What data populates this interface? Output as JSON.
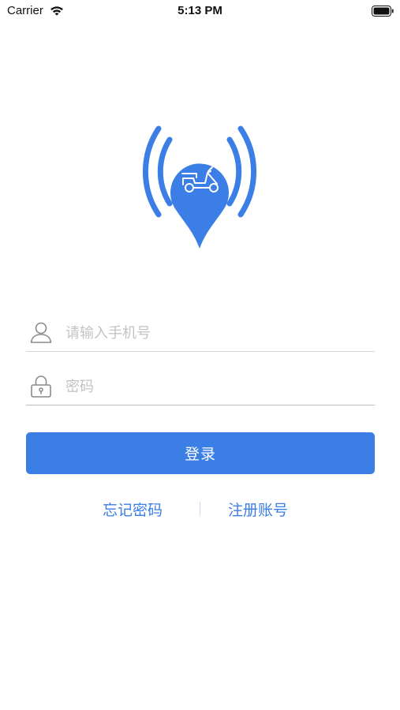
{
  "status_bar": {
    "carrier": "Carrier",
    "time": "5:13 PM"
  },
  "login": {
    "phone_placeholder": "请输入手机号",
    "password_placeholder": "密码",
    "login_button": "登录",
    "forgot_password": "忘记密码",
    "register": "注册账号"
  },
  "colors": {
    "accent": "#3b7ee6"
  },
  "icons": {
    "logo": "scooter-location-pin-signal-icon",
    "phone_field": "user-icon",
    "password_field": "lock-icon"
  }
}
